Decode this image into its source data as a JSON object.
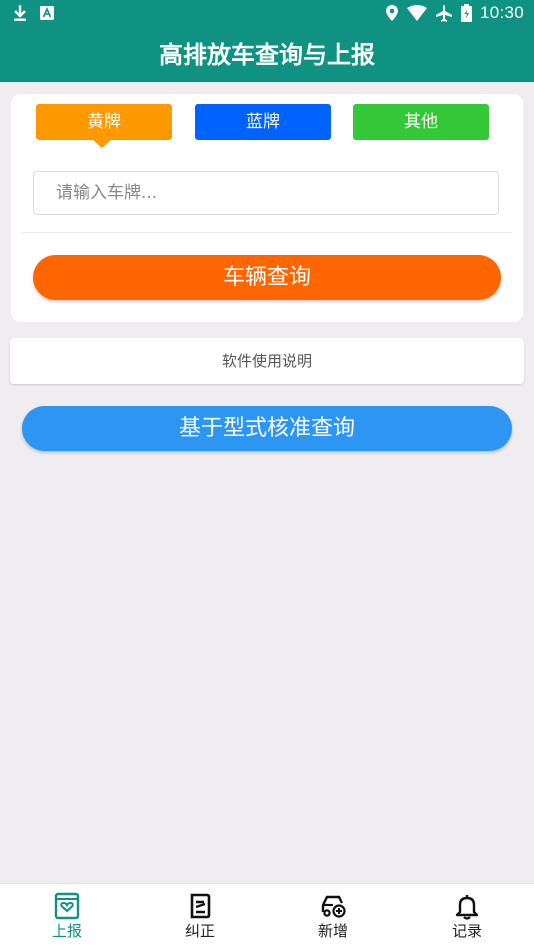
{
  "status_bar": {
    "time": "10:30",
    "left_icons": [
      "download-icon",
      "a-badge-icon"
    ],
    "right_icons": [
      "location-icon",
      "wifi-icon",
      "airplane-icon",
      "battery-icon"
    ]
  },
  "app_bar": {
    "title": "高排放车查询与上报"
  },
  "plate_types": [
    {
      "label": "黄牌",
      "color": "#fe9a00",
      "selected": true
    },
    {
      "label": "蓝牌",
      "color": "#0063ff",
      "selected": false
    },
    {
      "label": "其他",
      "color": "#34c838",
      "selected": false
    }
  ],
  "plate_input": {
    "placeholder": "请输入车牌...",
    "value": ""
  },
  "buttons": {
    "query": "车辆查询",
    "manual": "软件使用说明",
    "type_query": "基于型式核准查询"
  },
  "bottom_nav": [
    {
      "label": "上报",
      "icon": "report-icon",
      "active": true
    },
    {
      "label": "纠正",
      "icon": "correct-icon",
      "active": false
    },
    {
      "label": "新增",
      "icon": "add-car-icon",
      "active": false
    },
    {
      "label": "记录",
      "icon": "bell-icon",
      "active": false
    }
  ],
  "colors": {
    "primary": "#0f9282",
    "query_orange": "#ff6600",
    "type_blue": "#2d96f3",
    "background": "#efedef"
  }
}
